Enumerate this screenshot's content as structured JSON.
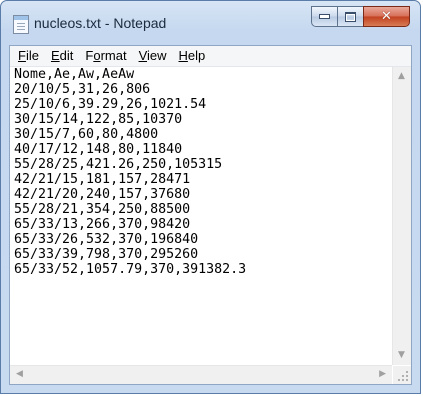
{
  "window": {
    "title": "nucleos.txt - Notepad"
  },
  "caption_buttons": {
    "close_glyph": "✕"
  },
  "menu": [
    {
      "accel": "F",
      "rest": "ile"
    },
    {
      "accel": "E",
      "rest": "dit"
    },
    {
      "pre": "F",
      "accel": "o",
      "rest": "rmat"
    },
    {
      "accel": "V",
      "rest": "iew"
    },
    {
      "accel": "H",
      "rest": "elp"
    }
  ],
  "document": {
    "lines": [
      "Nome,Ae,Aw,AeAw",
      "20/10/5,31,26,806",
      "25/10/6,39.29,26,1021.54",
      "30/15/14,122,85,10370",
      "30/15/7,60,80,4800",
      "40/17/12,148,80,11840",
      "55/28/25,421.26,250,105315",
      "42/21/15,181,157,28471",
      "42/21/20,240,157,37680",
      "55/28/21,354,250,88500",
      "65/33/13,266,370,98420",
      "65/33/26,532,370,196840",
      "65/33/39,798,370,295260",
      "65/33/52,1057.79,370,391382.3"
    ]
  },
  "scroll_glyphs": {
    "up": "▲",
    "down": "▼",
    "left": "◀",
    "right": "▶"
  }
}
